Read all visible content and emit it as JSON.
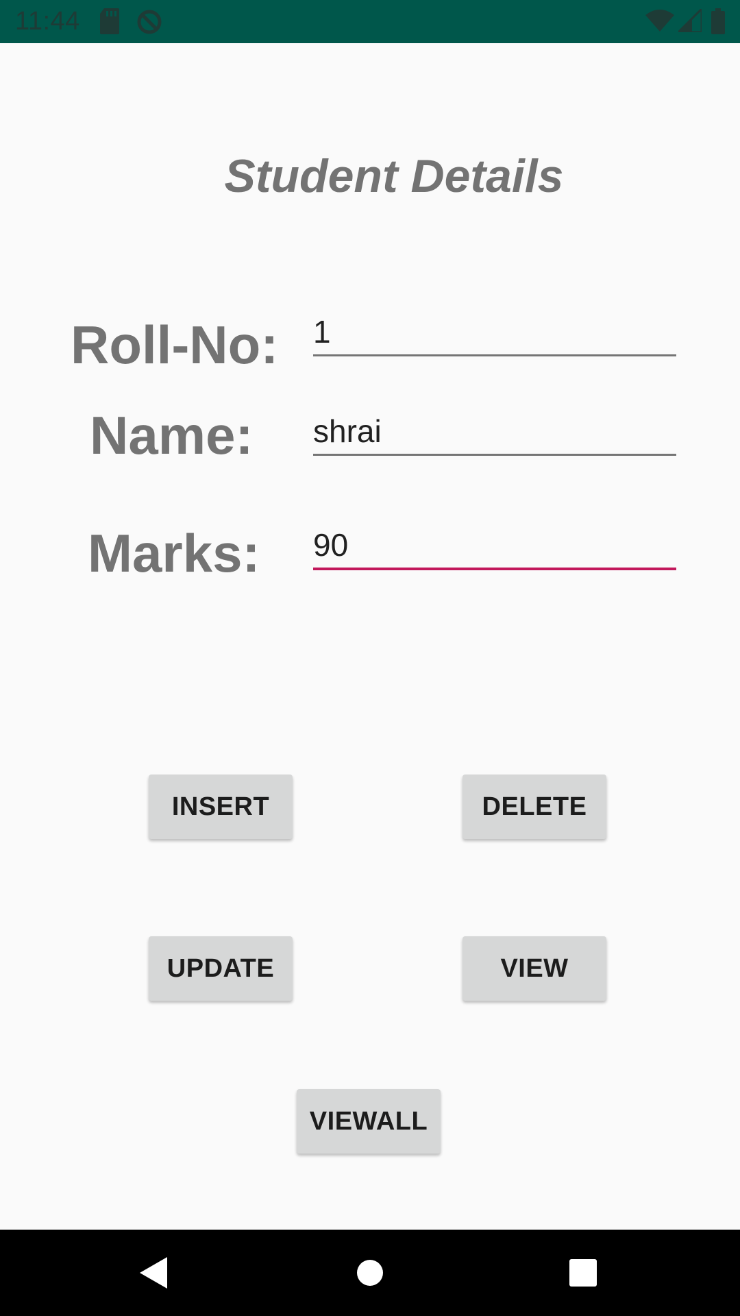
{
  "status_bar": {
    "time": "11:44",
    "icons": [
      "sd-card-icon",
      "sync-disabled-icon",
      "wifi-icon",
      "signal-icon",
      "battery-icon"
    ],
    "background_color": "#00574b"
  },
  "page": {
    "title": "Student Details"
  },
  "form": {
    "rollno": {
      "label": "Roll-No:",
      "value": "1"
    },
    "name": {
      "label": "Name:",
      "value": "shrai"
    },
    "marks": {
      "label": "Marks:",
      "value": "90",
      "focused": true,
      "accent_color": "#c2185b"
    }
  },
  "buttons": {
    "insert": "INSERT",
    "delete": "DELETE",
    "update": "UPDATE",
    "view": "VIEW",
    "viewall": "VIEWALL"
  },
  "nav_bar": {
    "icons": [
      "back-icon",
      "home-icon",
      "recents-icon"
    ]
  }
}
